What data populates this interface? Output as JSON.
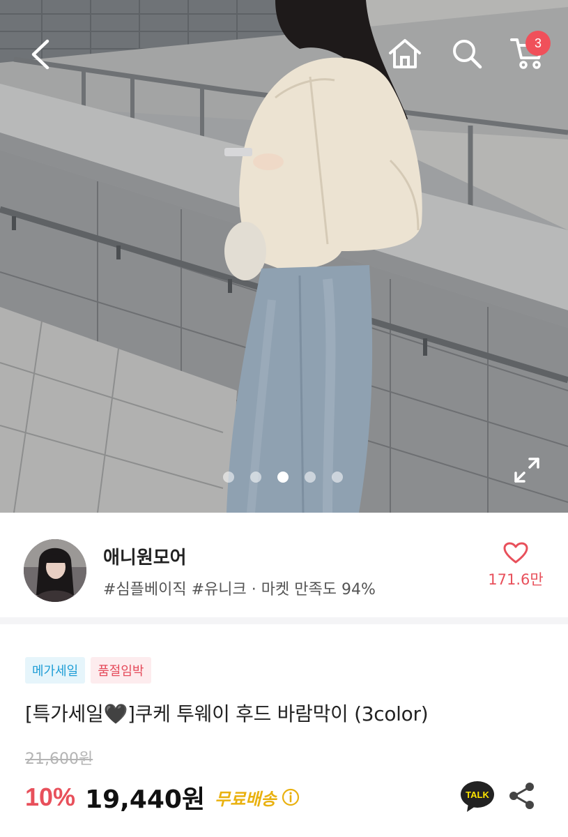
{
  "header": {
    "cart_count": "3"
  },
  "carousel": {
    "total_slides": 5,
    "active_index": 2
  },
  "seller": {
    "name": "애니원모어",
    "tags": "#심플베이직 #유니크 · 마켓 만족도 94%",
    "like_count": "171.6만"
  },
  "product": {
    "badges": [
      "메가세일",
      "품절임박"
    ],
    "title": "[특가세일🖤]쿠케 투웨이 후드 바람막이 (3color)",
    "original_price": "21,600원",
    "discount": "10%",
    "price": "19,440원",
    "shipping": "무료배송"
  },
  "actions": {
    "talk_label": "TALK"
  },
  "colors": {
    "accent_red": "#e8505b",
    "badge_blue": "#1f9ed6",
    "shipping_yellow": "#e9b10f",
    "kakao_yellow": "#fee500"
  },
  "icons": [
    "back-icon",
    "home-icon",
    "search-icon",
    "cart-icon",
    "expand-icon",
    "heart-icon",
    "info-icon",
    "kakao-talk-icon",
    "share-icon"
  ]
}
